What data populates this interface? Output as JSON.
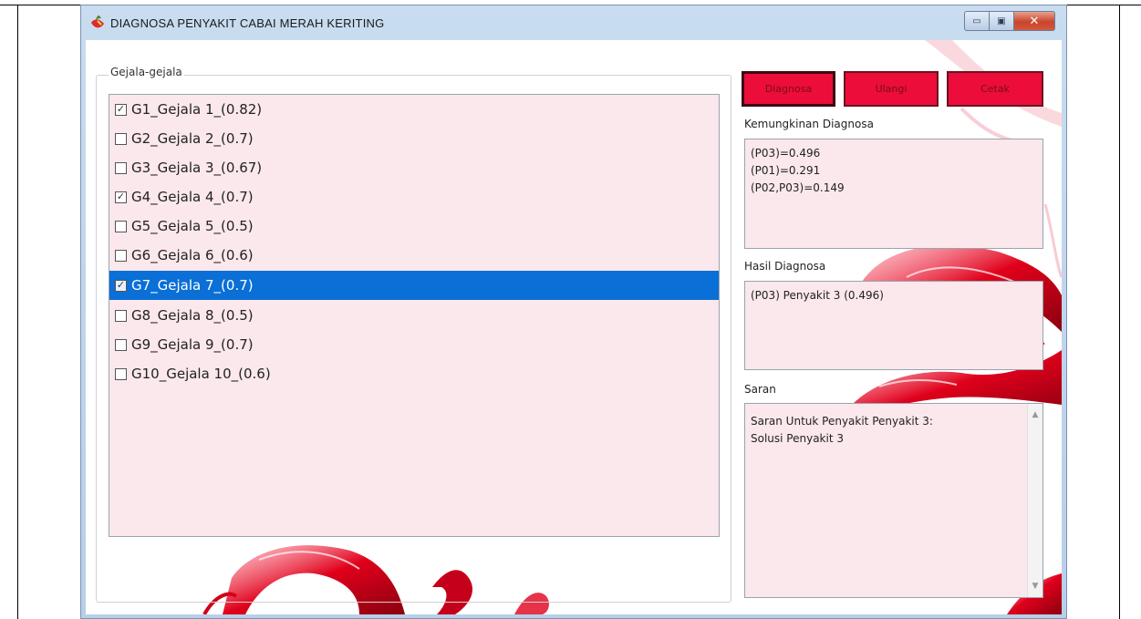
{
  "window": {
    "title": "DIAGNOSA PENYAKIT CABAI MERAH KERITING",
    "minimize_glyph": "▭",
    "maximize_glyph": "▣",
    "close_glyph": "✕"
  },
  "symptoms": {
    "group_label": "Gejala-gejala",
    "items": [
      {
        "label": "G1_Gejala 1_(0.82)",
        "checked": true,
        "selected": false
      },
      {
        "label": "G2_Gejala 2_(0.7)",
        "checked": false,
        "selected": false
      },
      {
        "label": "G3_Gejala 3_(0.67)",
        "checked": false,
        "selected": false
      },
      {
        "label": "G4_Gejala 4_(0.7)",
        "checked": true,
        "selected": false
      },
      {
        "label": "G5_Gejala 5_(0.5)",
        "checked": false,
        "selected": false
      },
      {
        "label": "G6_Gejala 6_(0.6)",
        "checked": false,
        "selected": false
      },
      {
        "label": "G7_Gejala 7_(0.7)",
        "checked": true,
        "selected": true
      },
      {
        "label": "G8_Gejala 8_(0.5)",
        "checked": false,
        "selected": false
      },
      {
        "label": "G9_Gejala 9_(0.7)",
        "checked": false,
        "selected": false
      },
      {
        "label": "G10_Gejala 10_(0.6)",
        "checked": false,
        "selected": false
      }
    ]
  },
  "buttons": {
    "diagnosa": "Diagnosa",
    "ulangi": "Ulangi",
    "cetak": "Cetak"
  },
  "possibilities": {
    "label": "Kemungkinan Diagnosa",
    "lines": [
      "(P03)=0.496",
      "(P01)=0.291",
      "(P02,P03)=0.149"
    ]
  },
  "result": {
    "label": "Hasil Diagnosa",
    "text": "(P03) Penyakit 3 (0.496)"
  },
  "advice": {
    "label": "Saran",
    "lines": [
      "Saran Untuk Penyakit Penyakit 3:",
      "Solusi Penyakit 3"
    ]
  },
  "colors": {
    "button_red": "#ec0d3a",
    "field_pink": "#fbe8ec",
    "selection_blue": "#0a6fd6"
  }
}
